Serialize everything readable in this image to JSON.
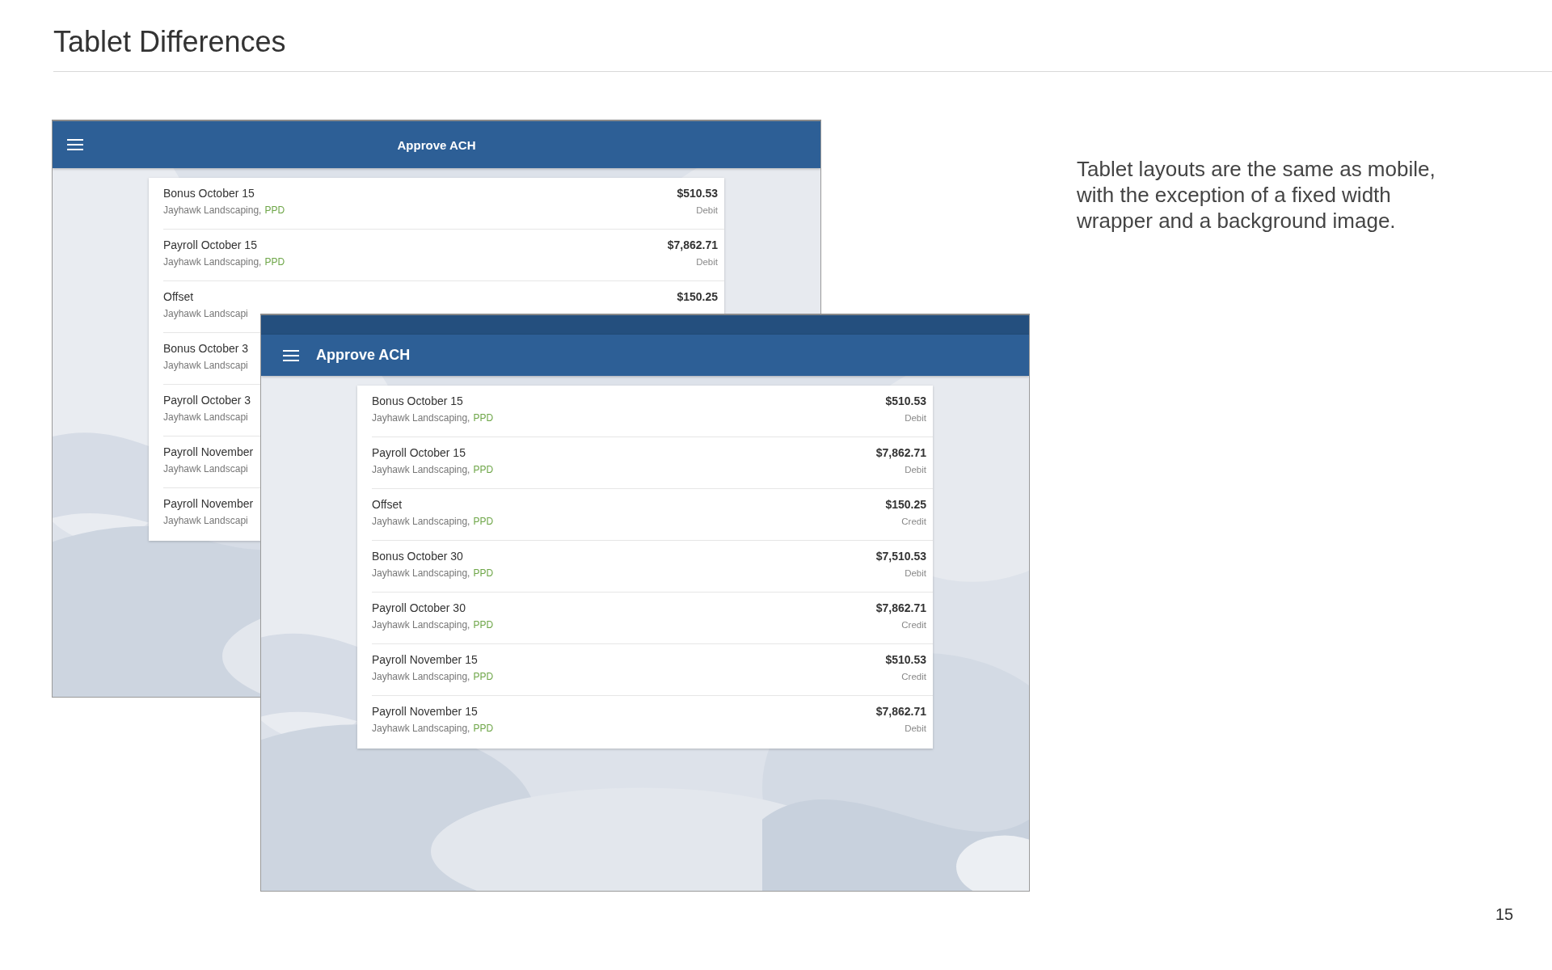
{
  "title": "Tablet Differences",
  "screens": [
    {
      "kind": "centered",
      "status_strip": false,
      "header": {
        "title": "Approve ACH"
      },
      "rows": [
        {
          "name": "Bonus October 15",
          "payee": "Jayhawk Landscaping,",
          "code": "PPD",
          "amount": "$510.53",
          "type": "Debit"
        },
        {
          "name": "Payroll October 15",
          "payee": "Jayhawk Landscaping,",
          "code": "PPD",
          "amount": "$7,862.71",
          "type": "Debit"
        },
        {
          "name": "Offset",
          "payee": "Jayhawk Landscapi",
          "amount": "$150.25"
        },
        {
          "name": "Bonus October 3",
          "payee": "Jayhawk Landscapi"
        },
        {
          "name": "Payroll October 3",
          "payee": "Jayhawk Landscapi"
        },
        {
          "name": "Payroll November",
          "payee": "Jayhawk Landscapi"
        },
        {
          "name": "Payroll November",
          "payee": "Jayhawk Landscapi"
        }
      ]
    },
    {
      "kind": "compact",
      "status_strip": true,
      "header": {
        "title": "Approve ACH"
      },
      "rows": [
        {
          "name": "Bonus October 15",
          "payee": "Jayhawk Landscaping,",
          "code": "PPD",
          "amount": "$510.53",
          "type": "Debit"
        },
        {
          "name": "Payroll October 15",
          "payee": "Jayhawk Landscaping,",
          "code": "PPD",
          "amount": "$7,862.71",
          "type": "Debit"
        },
        {
          "name": "Offset",
          "payee": "Jayhawk Landscaping,",
          "code": "PPD",
          "amount": "$150.25",
          "type": "Credit"
        },
        {
          "name": "Bonus October 30",
          "payee": "Jayhawk Landscaping,",
          "code": "PPD",
          "amount": "$7,510.53",
          "type": "Debit"
        },
        {
          "name": "Payroll October 30",
          "payee": "Jayhawk Landscaping,",
          "code": "PPD",
          "amount": "$7,862.71",
          "type": "Credit"
        },
        {
          "name": "Payroll November 15",
          "payee": "Jayhawk Landscaping,",
          "code": "PPD",
          "amount": "$510.53",
          "type": "Credit"
        },
        {
          "name": "Payroll November 15",
          "payee": "Jayhawk Landscaping,",
          "code": "PPD",
          "amount": "$7,862.71",
          "type": "Debit"
        }
      ]
    }
  ],
  "description": "Tablet layouts are the same as mobile, with the exception of a fixed width wrapper and a background image.",
  "page_number": "15"
}
